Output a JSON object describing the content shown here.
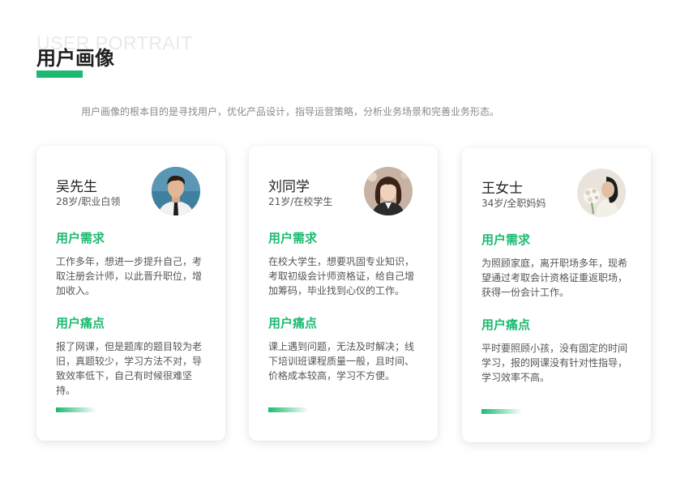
{
  "page": {
    "bg_title": "USER PORTRAIT",
    "title": "用户画像",
    "intro": "用户画像的根本目的是寻找用户，优化产品设计，指导运营策略，分析业务场景和完善业务形态。",
    "accent_color": "#1cba70"
  },
  "cards": [
    {
      "name": "吴先生",
      "meta": "28岁/职业白领",
      "avatar": "male-avatar-icon",
      "need_heading": "用户需求",
      "need_text": "工作多年，想进一步提升自己，考取注册会计师，以此晋升职位，增加收入。",
      "pain_heading": "用户痛点",
      "pain_text": "报了网课，但是题库的题目较为老旧，真题较少，学习方法不对，导致效率低下，自己有时候很难坚持。"
    },
    {
      "name": "刘同学",
      "meta": "21岁/在校学生",
      "avatar": "female-student-avatar-icon",
      "need_heading": "用户需求",
      "need_text": "在校大学生，想要巩固专业知识，考取初级会计师资格证，给自己增加筹码，毕业找到心仪的工作。",
      "pain_heading": "用户痛点",
      "pain_text": "课上遇到问题，无法及时解决；线下培训班课程质量一般，且时间、价格成本较高，学习不方便。"
    },
    {
      "name": "王女士",
      "meta": "34岁/全职妈妈",
      "avatar": "female-mother-avatar-icon",
      "need_heading": "用户需求",
      "need_text": "为照顾家庭，离开职场多年，现希望通过考取会计资格证重返职场，获得一份会计工作。",
      "pain_heading": "用户痛点",
      "pain_text": "平时要照顾小孩，没有固定的时间学习，报的网课没有针对性指导，学习效率不高。"
    }
  ]
}
